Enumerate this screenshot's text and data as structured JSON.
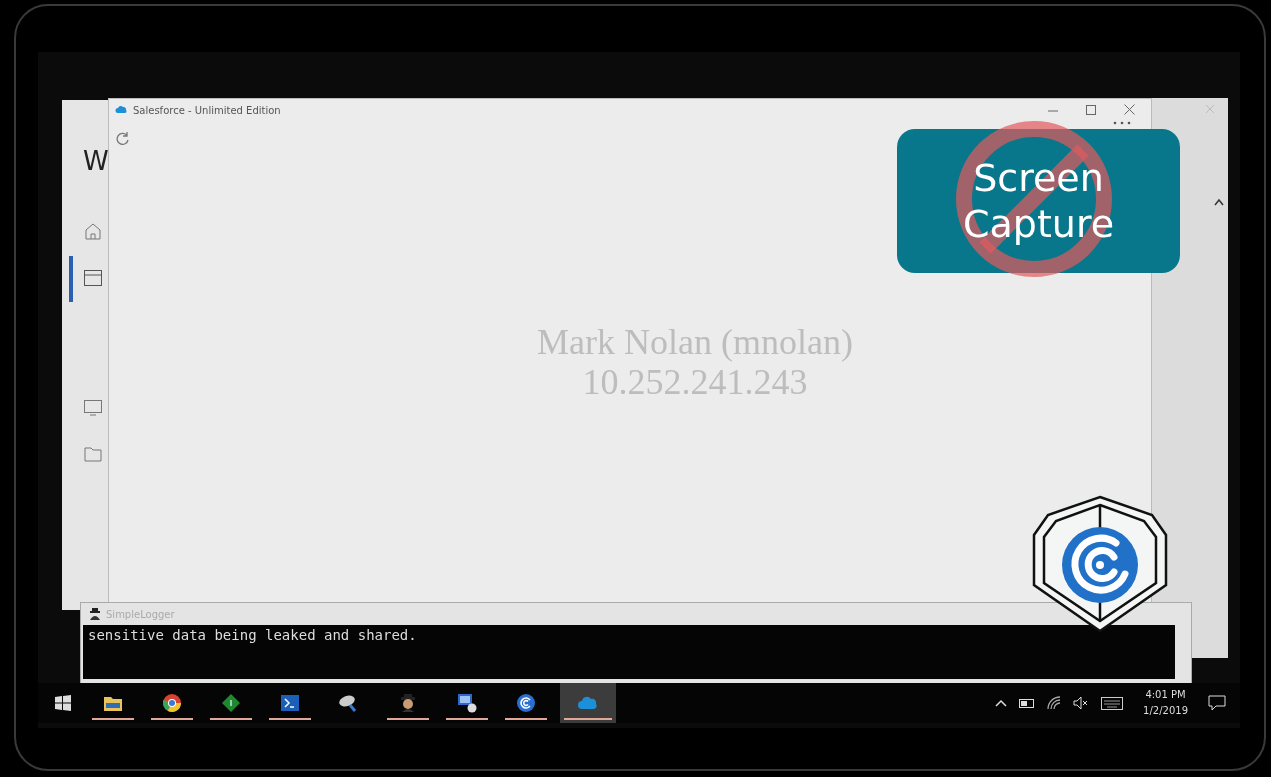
{
  "back_window": {
    "heading": "W"
  },
  "browser_window": {
    "title": "Salesforce - Unlimited Edition",
    "watermark_lines": [
      "Mark Nolan (mnolan)",
      "10.252.241.243"
    ]
  },
  "overlay_badge": {
    "lines": [
      "Screen",
      "Capture"
    ]
  },
  "logger_window": {
    "title": "SimpleLogger",
    "output": "sensitive data being leaked and shared."
  },
  "taskbar": {
    "apps": [
      {
        "kind": "folder",
        "running": true,
        "selected": false
      },
      {
        "kind": "browser",
        "running": true,
        "selected": false
      },
      {
        "kind": "diamond",
        "running": true,
        "selected": false
      },
      {
        "kind": "terminal",
        "running": true,
        "selected": false
      },
      {
        "kind": "satellite",
        "running": false,
        "selected": false
      },
      {
        "kind": "spy",
        "running": true,
        "selected": false
      },
      {
        "kind": "computer",
        "running": true,
        "selected": false
      },
      {
        "kind": "spiral",
        "running": true,
        "selected": false
      },
      {
        "kind": "cloud",
        "running": true,
        "selected": true
      }
    ],
    "time": "4:01 PM",
    "date": "1/2/2019"
  }
}
